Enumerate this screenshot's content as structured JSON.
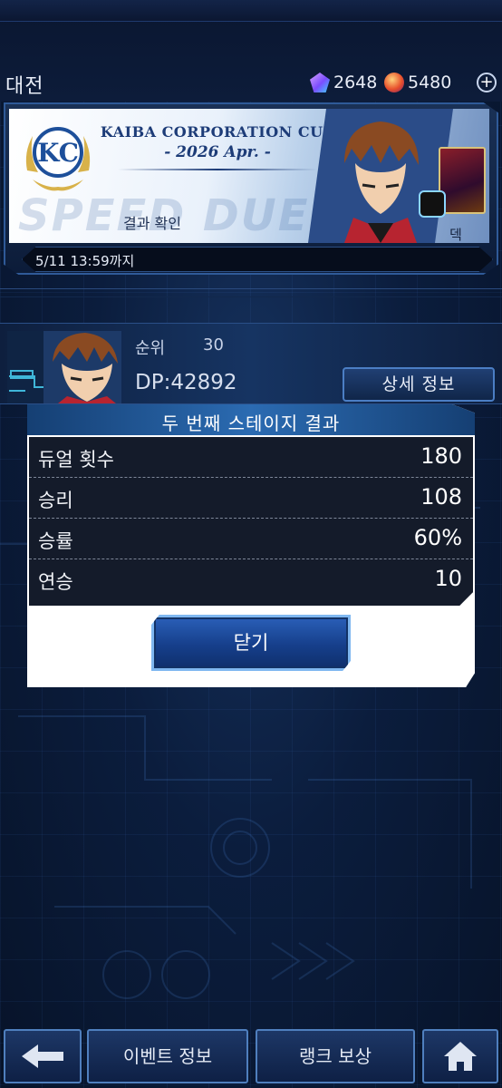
{
  "header": {
    "page_title": "대전",
    "gems": "2648",
    "orbs": "5480",
    "plus_label": "+"
  },
  "banner": {
    "logo_text": "KC",
    "title": "KAIBA CORPORATION CUP",
    "subtitle": "- 2026 Apr. -",
    "result_check": "결과 확인",
    "deck_label": "덱",
    "deadline": "5/11 13:59까지"
  },
  "rank": {
    "label": "순위",
    "value": "30",
    "dp": "DP:42892",
    "detail_button": "상세 정보"
  },
  "modal": {
    "title": "두 번째 스테이지 결과",
    "rows": [
      {
        "label": "듀얼 횟수",
        "value": "180"
      },
      {
        "label": "승리",
        "value": "108"
      },
      {
        "label": "승률",
        "value": "60%"
      },
      {
        "label": "연승",
        "value": "10"
      }
    ],
    "close_button": "닫기"
  },
  "bottom_nav": {
    "back_icon": "arrow-left-icon",
    "event_info": "이벤트 정보",
    "rank_reward": "랭크 보상",
    "home_icon": "home-icon"
  },
  "colors": {
    "background": "#0b1d3d",
    "accent_blue": "#2b6bb2",
    "button_border": "#4f7fbe"
  }
}
